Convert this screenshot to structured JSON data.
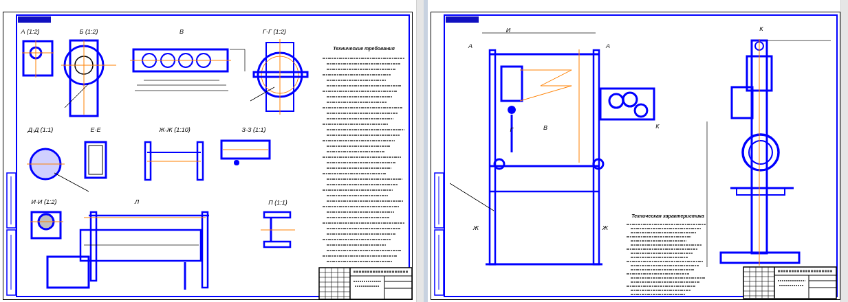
{
  "sheets": [
    {
      "kind": "assembly",
      "view_labels": [
        "А (1:2)",
        "Б (1:2)",
        "В",
        "Г-Г (1:2)",
        "Д-Д (1:1)",
        "Е-Е",
        "Ж-Ж (1:10)",
        "З-З (1:1)",
        "И-И (1:2)",
        "Л",
        "П (1:1)"
      ],
      "heading": "Технические требования"
    },
    {
      "kind": "general",
      "view_labels": [
        "И",
        "А",
        "А",
        "В",
        "Г",
        "К",
        "К",
        "Ж",
        "Ж"
      ],
      "heading": "Техническая характеристика"
    }
  ]
}
